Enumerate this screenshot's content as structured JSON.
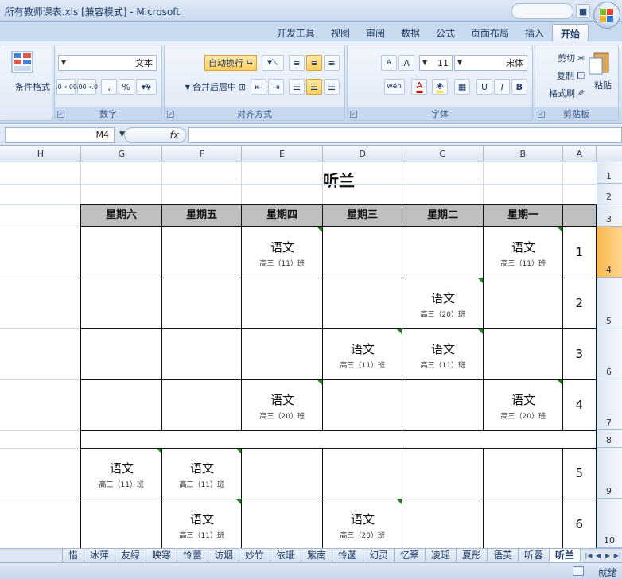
{
  "window": {
    "title": "所有教师课表.xls [兼容模式] - Microsoft"
  },
  "ribbon_tabs": [
    "开始",
    "插入",
    "页面布局",
    "公式",
    "数据",
    "审阅",
    "视图",
    "开发工具"
  ],
  "ribbon": {
    "clipboard": {
      "label": "剪贴板",
      "paste": "粘贴",
      "cut": "剪切",
      "copy": "复制",
      "format_painter": "格式刷"
    },
    "font": {
      "label": "字体",
      "font_name": "宋体",
      "font_size": "11",
      "bold": "B",
      "italic": "I",
      "underline": "U",
      "grow": "A",
      "shrink": "A",
      "font_color_letter": "A",
      "phonetic": "wén"
    },
    "alignment": {
      "label": "对齐方式",
      "wrap_text": "自动换行",
      "merge_center": "合并后居中"
    },
    "number": {
      "label": "数字",
      "format": "文本",
      "percent": "%",
      "comma": ",",
      "inc_decimal": ".00→.0",
      "dec_decimal": ".0→.00"
    },
    "styles": {
      "conditional": "条件格式"
    }
  },
  "formula_bar": {
    "name_box": "M4",
    "fx": "fx",
    "content": ""
  },
  "columns": [
    "A",
    "B",
    "C",
    "D",
    "E",
    "F",
    "G",
    "H"
  ],
  "rows": [
    "1",
    "2",
    "3",
    "4",
    "5",
    "6",
    "7",
    "8",
    "9",
    "10"
  ],
  "sheet": {
    "title": "听兰",
    "weekdays": [
      "星期一",
      "星期二",
      "星期三",
      "星期四",
      "星期五",
      "星期六"
    ],
    "periods": [
      "1",
      "2",
      "3",
      "4",
      "5",
      "6"
    ],
    "entries": [
      {
        "period": 1,
        "day": 1,
        "subject": "语文",
        "class": "高三（11）班"
      },
      {
        "period": 1,
        "day": 4,
        "subject": "语文",
        "class": "高三（11）班"
      },
      {
        "period": 2,
        "day": 2,
        "subject": "语文",
        "class": "高三（20）班"
      },
      {
        "period": 3,
        "day": 2,
        "subject": "语文",
        "class": "高三（11）班"
      },
      {
        "period": 3,
        "day": 3,
        "subject": "语文",
        "class": "高三（11）班"
      },
      {
        "period": 4,
        "day": 1,
        "subject": "语文",
        "class": "高三（20）班"
      },
      {
        "period": 4,
        "day": 4,
        "subject": "语文",
        "class": "高三（20）班"
      },
      {
        "period": 5,
        "day": 5,
        "subject": "语文",
        "class": "高三（11）班"
      },
      {
        "period": 5,
        "day": 6,
        "subject": "语文",
        "class": "高三（11）班"
      },
      {
        "period": 6,
        "day": 3,
        "subject": "语文",
        "class": "高三（20）班"
      },
      {
        "period": 6,
        "day": 5,
        "subject": "语文",
        "class": "高三（11）班"
      }
    ]
  },
  "sheet_tabs": [
    "听兰",
    "听蓉",
    "语芙",
    "夏彤",
    "凌瑶",
    "忆翠",
    "幻灵",
    "怜菡",
    "紫南",
    "依珊",
    "妙竹",
    "访烟",
    "怜蕾",
    "映寒",
    "友绿",
    "冰萍",
    "惜"
  ],
  "status": {
    "ready": "就绪"
  }
}
